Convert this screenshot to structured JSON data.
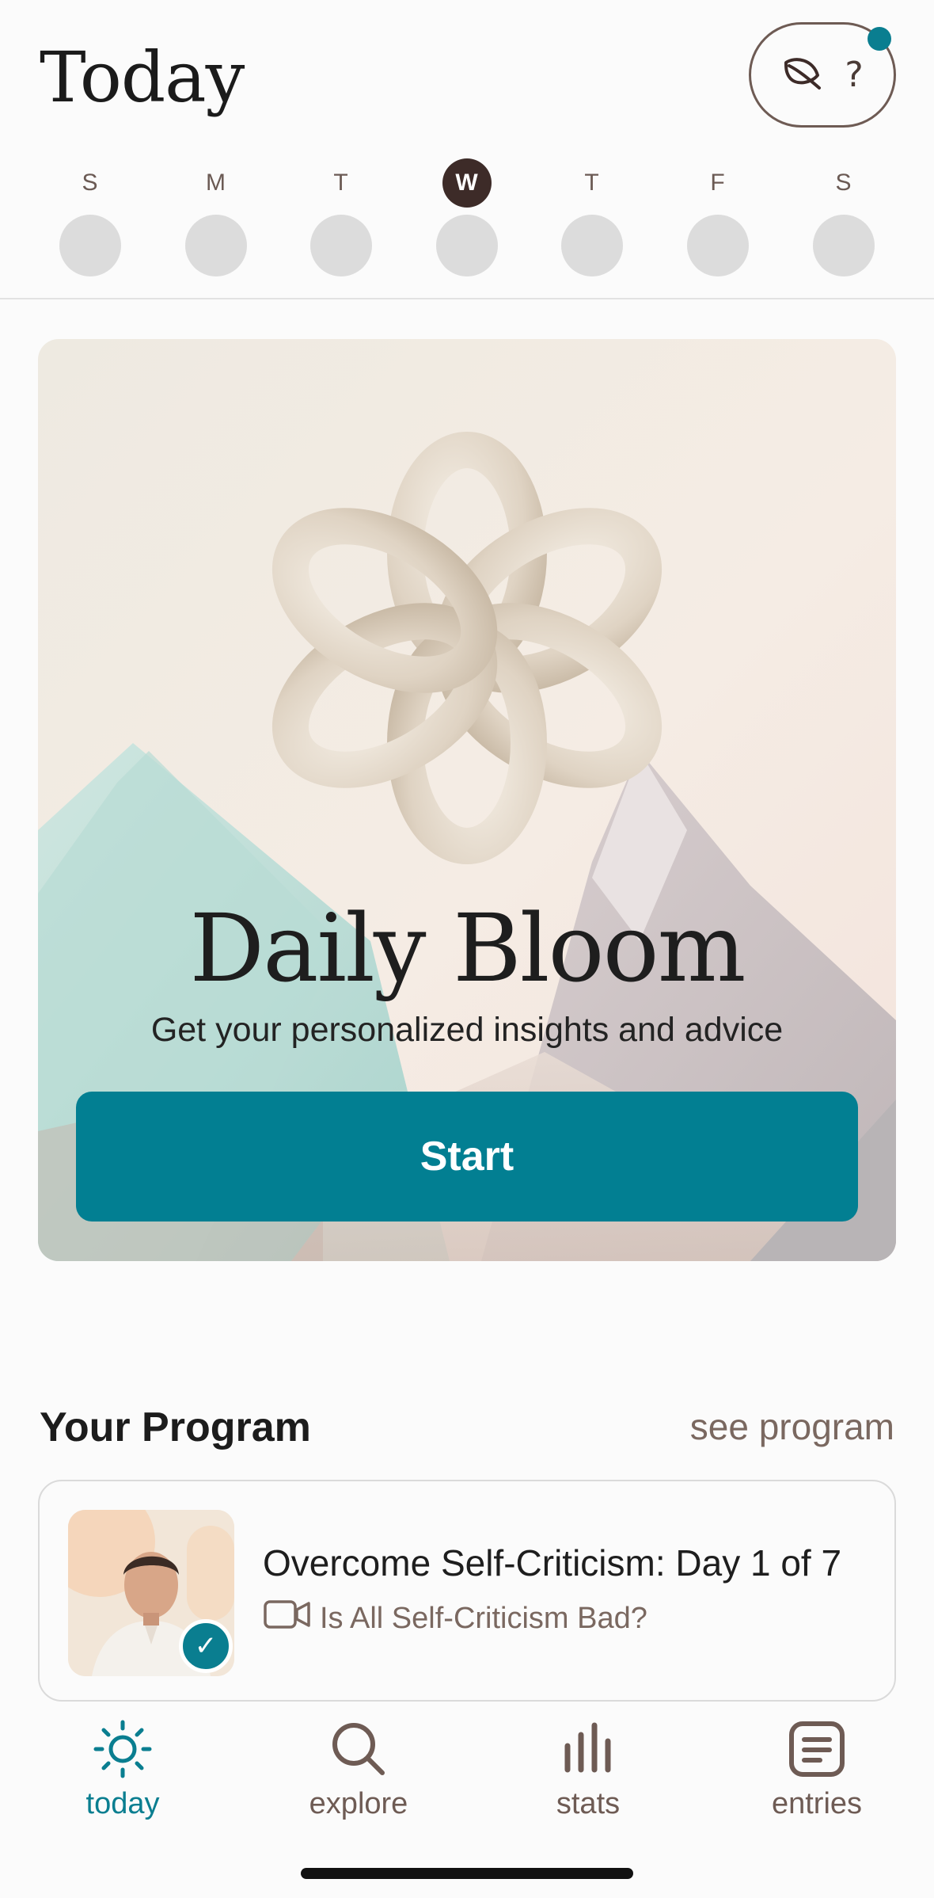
{
  "header": {
    "title": "Today",
    "help_label": "?"
  },
  "week": {
    "days": [
      "S",
      "M",
      "T",
      "W",
      "T",
      "F",
      "S"
    ],
    "active_index": 3
  },
  "hero": {
    "title": "Daily Bloom",
    "subtitle": "Get your personalized insights and advice",
    "start_label": "Start"
  },
  "program": {
    "heading": "Your Program",
    "see_link": "see program",
    "name": "Overcome Self-Criticism: Day 1 of 7",
    "lesson": "Is All Self-Criticism Bad?",
    "completed": true
  },
  "nav": {
    "items": [
      {
        "label": "today",
        "icon": "sun-icon",
        "active": true
      },
      {
        "label": "explore",
        "icon": "search-icon",
        "active": false
      },
      {
        "label": "stats",
        "icon": "bar-chart-icon",
        "active": false
      },
      {
        "label": "entries",
        "icon": "journal-icon",
        "active": false
      }
    ]
  },
  "colors": {
    "accent": "#027f92",
    "active_day": "#3d2b28",
    "brown_text": "#6e5b54"
  }
}
